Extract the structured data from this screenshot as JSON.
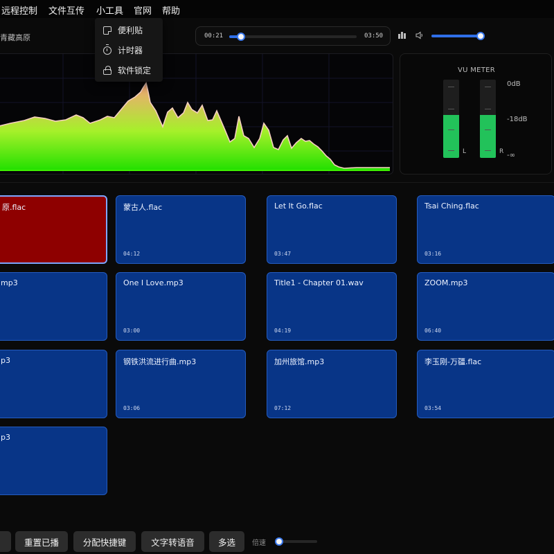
{
  "menu": [
    "远程控制",
    "文件互传",
    "小工具",
    "官网",
    "帮助"
  ],
  "dropdown": [
    {
      "label": "便利贴",
      "icon": "note-icon"
    },
    {
      "label": "计时器",
      "icon": "timer-icon"
    },
    {
      "label": "软件锁定",
      "icon": "lock-icon"
    }
  ],
  "player": {
    "song_title": "青藏高原",
    "elapsed": "00:21",
    "duration": "03:50",
    "progress": 0.09,
    "volume": 0.94
  },
  "vu_meter": {
    "title": "VU METER",
    "left_label": "L",
    "right_label": "R",
    "scale": [
      "0dB",
      "-18dB",
      "-∞"
    ],
    "left_level": 0.55,
    "right_level": 0.55
  },
  "spectrum": {
    "fill_top_color": "#f6a27a",
    "fill_bottom_color": "#22e000",
    "line_color": "#f7d0c0"
  },
  "cards": [
    {
      "name": "原.flac",
      "time": "",
      "playing": true
    },
    {
      "name": "蒙古人.flac",
      "time": "04:12"
    },
    {
      "name": "Let It Go.flac",
      "time": "03:47"
    },
    {
      "name": "Tsai Ching.flac",
      "time": "03:16"
    },
    {
      "name": "mp3",
      "time": ""
    },
    {
      "name": "One I Love.mp3",
      "time": "03:00"
    },
    {
      "name": "Title1 - Chapter 01.wav",
      "time": "04:19"
    },
    {
      "name": "ZOOM.mp3",
      "time": "06:40"
    },
    {
      "name": "p3",
      "time": ""
    },
    {
      "name": "钢铁洪流进行曲.mp3",
      "time": "03:06"
    },
    {
      "name": "加州旅馆.mp3",
      "time": "07:12"
    },
    {
      "name": "李玉刚-万疆.flac",
      "time": "03:54"
    },
    {
      "name": "p3",
      "time": ""
    }
  ],
  "bottom_bar": {
    "buttons": [
      "重置已播",
      "分配快捷键",
      "文字转语音",
      "多选"
    ],
    "speed_label": "倍速",
    "speed": 0.06
  },
  "colors": {
    "card_bg": "#083587",
    "card_playing_bg": "#8e0000",
    "accent": "#2f6fe8",
    "vu_green": "#22c25a"
  }
}
